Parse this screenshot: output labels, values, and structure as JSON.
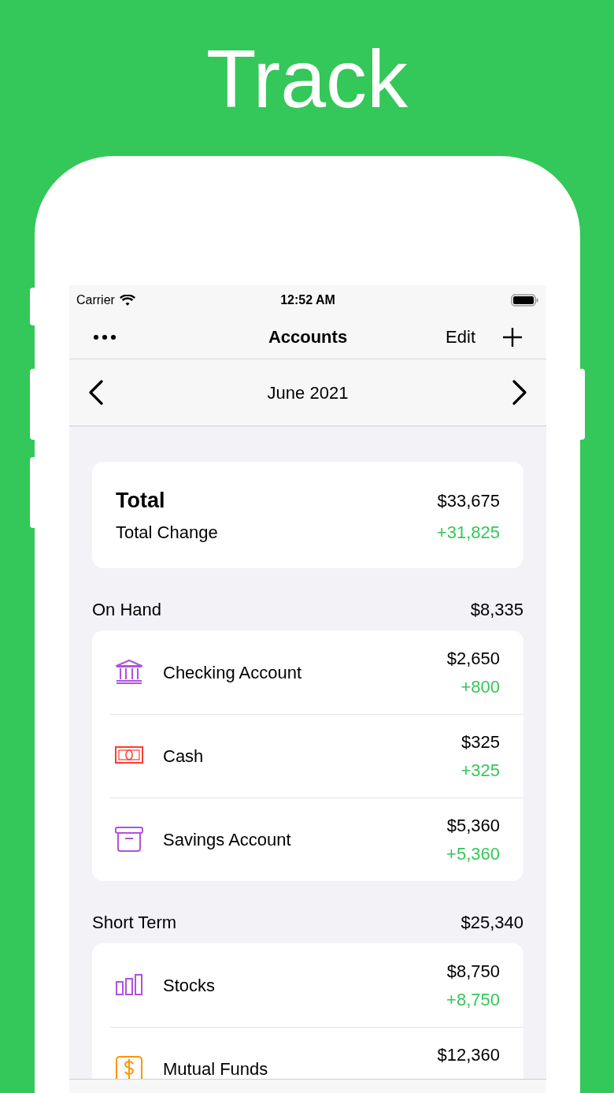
{
  "headline": "Track",
  "status_bar": {
    "carrier": "Carrier",
    "time": "12:52 AM"
  },
  "nav_bar": {
    "title": "Accounts",
    "edit": "Edit"
  },
  "month_bar": {
    "label": "June 2021"
  },
  "total_card": {
    "title": "Total",
    "amount": "$33,675",
    "change_label": "Total Change",
    "change": "+31,825"
  },
  "sections": [
    {
      "title": "On Hand",
      "total": "$8,335",
      "accounts": [
        {
          "kind": "bank",
          "color": "#af52de",
          "name": "Checking Account",
          "amount": "$2,650",
          "change": "+800"
        },
        {
          "kind": "cash",
          "color": "#ff3b30",
          "name": "Cash",
          "amount": "$325",
          "change": "+325"
        },
        {
          "kind": "box",
          "color": "#af52de",
          "name": "Savings Account",
          "amount": "$5,360",
          "change": "+5,360"
        }
      ]
    },
    {
      "title": "Short Term",
      "total": "$25,340",
      "accounts": [
        {
          "kind": "chart",
          "color": "#af52de",
          "name": "Stocks",
          "amount": "$8,750",
          "change": "+8,750"
        },
        {
          "kind": "dollar",
          "color": "#ff9500",
          "name": "Mutual Funds",
          "amount": "$12,360"
        }
      ]
    }
  ]
}
